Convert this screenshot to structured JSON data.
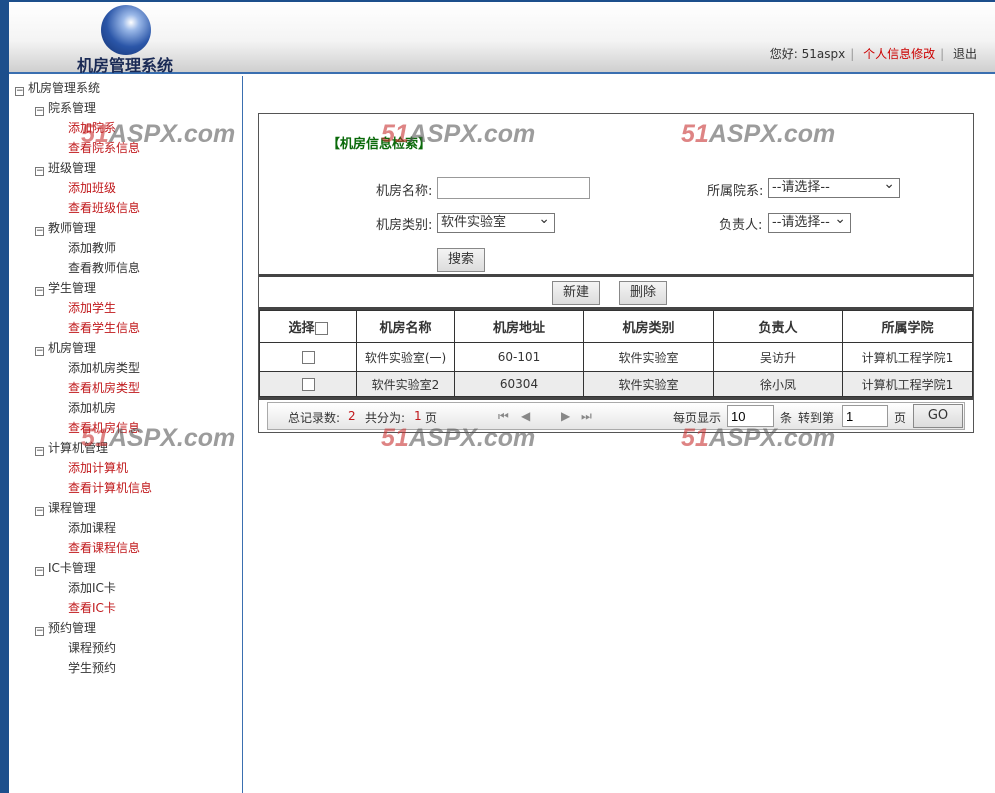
{
  "header": {
    "logo_text": "机房管理系统",
    "greeting": "您好:",
    "username": "51aspx",
    "profile_link": "个人信息修改",
    "logout": "退出"
  },
  "sidebar": {
    "root": "机房管理系统",
    "groups": [
      {
        "label": "院系管理",
        "items": [
          {
            "label": "添加院系",
            "red": true
          },
          {
            "label": "查看院系信息",
            "red": true
          }
        ]
      },
      {
        "label": "班级管理",
        "items": [
          {
            "label": "添加班级",
            "red": true
          },
          {
            "label": "查看班级信息",
            "red": true
          }
        ]
      },
      {
        "label": "教师管理",
        "items": [
          {
            "label": "添加教师",
            "red": false
          },
          {
            "label": "查看教师信息",
            "red": false
          }
        ]
      },
      {
        "label": "学生管理",
        "items": [
          {
            "label": "添加学生",
            "red": true
          },
          {
            "label": "查看学生信息",
            "red": true
          }
        ]
      },
      {
        "label": "机房管理",
        "items": [
          {
            "label": "添加机房类型",
            "red": false
          },
          {
            "label": "查看机房类型",
            "red": true
          },
          {
            "label": "添加机房",
            "red": false
          },
          {
            "label": "查看机房信息",
            "red": true
          }
        ]
      },
      {
        "label": "计算机管理",
        "items": [
          {
            "label": "添加计算机",
            "red": true
          },
          {
            "label": "查看计算机信息",
            "red": true
          }
        ]
      },
      {
        "label": "课程管理",
        "items": [
          {
            "label": "添加课程",
            "red": false
          },
          {
            "label": "查看课程信息",
            "red": true
          }
        ]
      },
      {
        "label": "IC卡管理",
        "items": [
          {
            "label": "添加IC卡",
            "red": false
          },
          {
            "label": "查看IC卡",
            "red": true
          }
        ]
      },
      {
        "label": "预约管理",
        "items": [
          {
            "label": "课程预约",
            "red": false
          },
          {
            "label": "学生预约",
            "red": false
          }
        ]
      }
    ]
  },
  "search": {
    "title": "【机房信息检索】",
    "name_label": "机房名称:",
    "name_value": "",
    "dept_label": "所属院系:",
    "dept_value": "--请选择--",
    "type_label": "机房类别:",
    "type_value": "软件实验室",
    "manager_label": "负责人:",
    "manager_value": "--请选择--",
    "search_button": "搜索"
  },
  "actions": {
    "new": "新建",
    "delete": "删除"
  },
  "table": {
    "headers": [
      "选择",
      "机房名称",
      "机房地址",
      "机房类别",
      "负责人",
      "所属学院"
    ],
    "rows": [
      [
        "软件实验室(一)",
        "60-101",
        "软件实验室",
        "吴访升",
        "计算机工程学院1"
      ],
      [
        "软件实验室2",
        "60304",
        "软件实验室",
        "徐小凤",
        "计算机工程学院1"
      ]
    ]
  },
  "pager": {
    "total_label": "总记录数:",
    "total": "2",
    "pages_label": "共分为:",
    "pages": "1",
    "page_unit": "页",
    "per_page_label": "每页显示",
    "per_page": "10",
    "per_page_unit": "条",
    "goto_label": "转到第",
    "goto_value": "1",
    "goto_unit": "页",
    "go": "GO"
  },
  "watermark": {
    "red": "51",
    "grey": "ASPX.com"
  }
}
